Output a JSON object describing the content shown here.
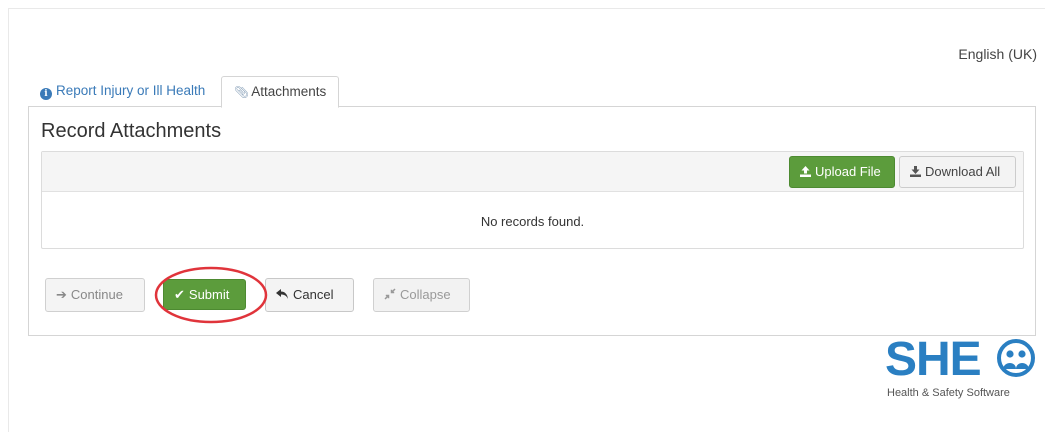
{
  "header": {
    "language": "English (UK)"
  },
  "tabs": [
    {
      "label": "Report Injury or Ill Health",
      "active": false,
      "icon": "info-circle-icon"
    },
    {
      "label": "Attachments",
      "active": true,
      "icon": "paperclip-icon"
    }
  ],
  "panel": {
    "title": "Record Attachments",
    "upload_label": "Upload File",
    "download_label": "Download All",
    "empty_message": "No records found."
  },
  "actions": {
    "continue_label": "Continue",
    "submit_label": "Submit",
    "cancel_label": "Cancel",
    "collapse_label": "Collapse"
  },
  "logo": {
    "letters": "SHE",
    "tagline": "Health & Safety Software"
  },
  "colors": {
    "accent_blue": "#3a7ab8",
    "success_green": "#5c9c3c",
    "highlight_red": "#e0343b",
    "logo_blue": "#2a7fc2"
  }
}
